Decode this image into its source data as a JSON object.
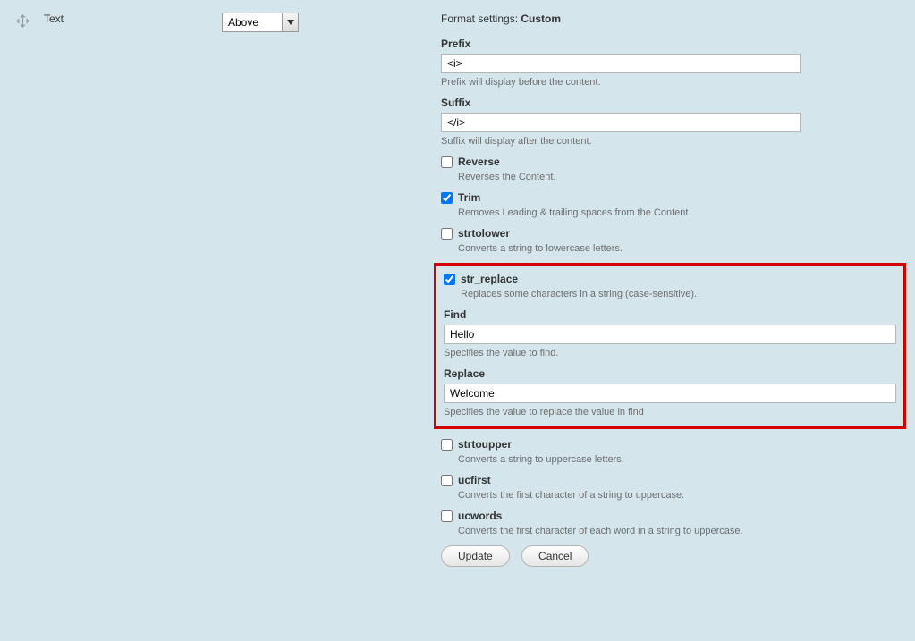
{
  "left": {
    "text_label": "Text"
  },
  "mid": {
    "placement_value": "Above"
  },
  "header": {
    "label": "Format settings:",
    "value": "Custom"
  },
  "prefix": {
    "label": "Prefix",
    "value": "<i>",
    "desc": "Prefix will display before the content."
  },
  "suffix": {
    "label": "Suffix",
    "value": "</i>",
    "desc": "Suffix will display after the content."
  },
  "reverse": {
    "label": "Reverse",
    "desc": "Reverses the Content."
  },
  "trim": {
    "label": "Trim",
    "desc": "Removes Leading & trailing spaces from the Content."
  },
  "strtolower": {
    "label": "strtolower",
    "desc": "Converts a string to lowercase letters."
  },
  "str_replace": {
    "label": "str_replace",
    "desc": "Replaces some characters in a string (case-sensitive).",
    "find_label": "Find",
    "find_value": "Hello",
    "find_desc": "Specifies the value to find.",
    "replace_label": "Replace",
    "replace_value": "Welcome",
    "replace_desc": "Specifies the value to replace the value in find"
  },
  "strtoupper": {
    "label": "strtoupper",
    "desc": "Converts a string to uppercase letters."
  },
  "ucfirst": {
    "label": "ucfirst",
    "desc": "Converts the first character of a string to uppercase."
  },
  "ucwords": {
    "label": "ucwords",
    "desc": "Converts the first character of each word in a string to uppercase."
  },
  "actions": {
    "update": "Update",
    "cancel": "Cancel"
  }
}
